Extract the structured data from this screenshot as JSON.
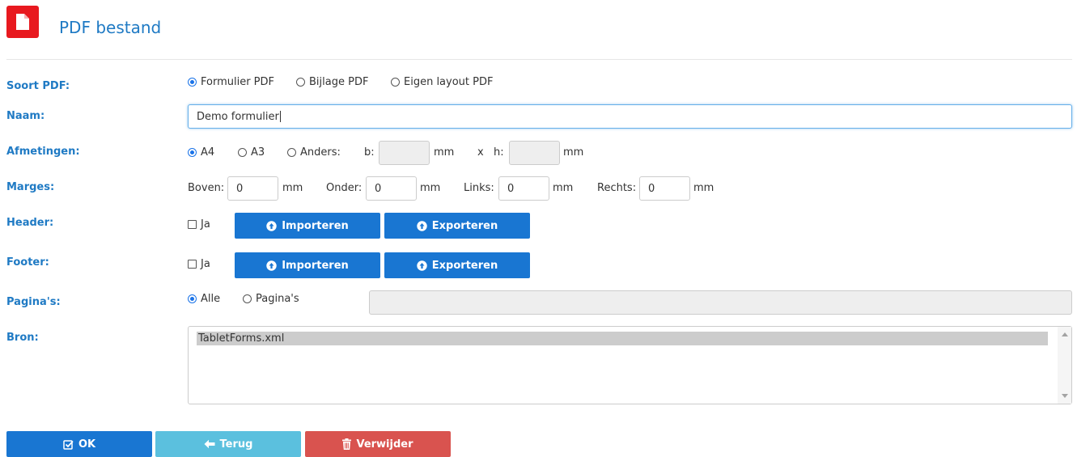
{
  "header": {
    "title": "PDF bestand",
    "icon": "pdf-file-icon"
  },
  "fields": {
    "soort_pdf": {
      "label": "Soort PDF:",
      "options": [
        "Formulier PDF",
        "Bijlage PDF",
        "Eigen layout PDF"
      ],
      "selected": "Formulier PDF"
    },
    "naam": {
      "label": "Naam:",
      "value": "Demo formulier"
    },
    "afmetingen": {
      "label": "Afmetingen:",
      "options": [
        "A4",
        "A3",
        "Anders:"
      ],
      "selected": "A4",
      "b_label": "b:",
      "b_value": "",
      "b_unit": "mm",
      "x_sep": "x",
      "h_label": "h:",
      "h_value": "",
      "h_unit": "mm"
    },
    "marges": {
      "label": "Marges:",
      "boven_label": "Boven:",
      "boven_value": "0",
      "onder_label": "Onder:",
      "onder_value": "0",
      "links_label": "Links:",
      "links_value": "0",
      "rechts_label": "Rechts:",
      "rechts_value": "0",
      "unit": "mm"
    },
    "header": {
      "label": "Header:",
      "checkbox_label": "Ja",
      "checked": false,
      "import_label": "Importeren",
      "export_label": "Exporteren"
    },
    "footer": {
      "label": "Footer:",
      "checkbox_label": "Ja",
      "checked": false,
      "import_label": "Importeren",
      "export_label": "Exporteren"
    },
    "paginas": {
      "label": "Pagina's:",
      "options": [
        "Alle",
        "Pagina's"
      ],
      "selected": "Alle",
      "value": ""
    },
    "bron": {
      "label": "Bron:",
      "items": [
        "TabletForms.xml"
      ],
      "selected": "TabletForms.xml"
    }
  },
  "actions": {
    "ok_label": "OK",
    "back_label": "Terug",
    "delete_label": "Verwijder"
  },
  "colors": {
    "accent": "#1f7ac4",
    "primary_button": "#1976d2",
    "info_button": "#5bc0de",
    "danger_button": "#d9534f",
    "pdf_icon": "#e8191f"
  }
}
